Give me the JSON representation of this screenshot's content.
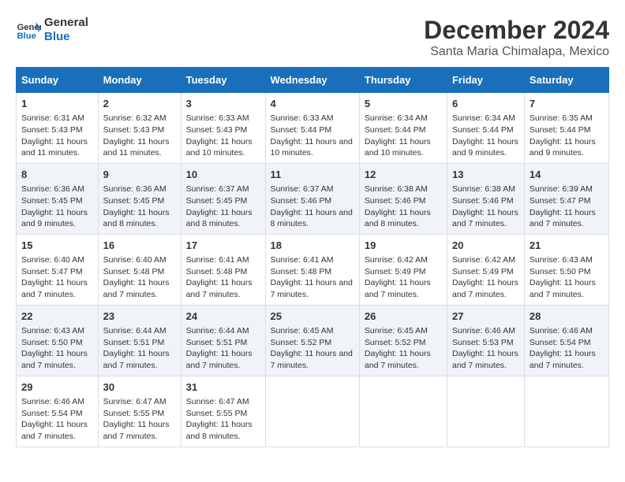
{
  "logo": {
    "line1": "General",
    "line2": "Blue"
  },
  "title": "December 2024",
  "subtitle": "Santa Maria Chimalapa, Mexico",
  "days_of_week": [
    "Sunday",
    "Monday",
    "Tuesday",
    "Wednesday",
    "Thursday",
    "Friday",
    "Saturday"
  ],
  "weeks": [
    [
      {
        "day": "1",
        "info": "Sunrise: 6:31 AM\nSunset: 5:43 PM\nDaylight: 11 hours and 11 minutes."
      },
      {
        "day": "2",
        "info": "Sunrise: 6:32 AM\nSunset: 5:43 PM\nDaylight: 11 hours and 11 minutes."
      },
      {
        "day": "3",
        "info": "Sunrise: 6:33 AM\nSunset: 5:43 PM\nDaylight: 11 hours and 10 minutes."
      },
      {
        "day": "4",
        "info": "Sunrise: 6:33 AM\nSunset: 5:44 PM\nDaylight: 11 hours and 10 minutes."
      },
      {
        "day": "5",
        "info": "Sunrise: 6:34 AM\nSunset: 5:44 PM\nDaylight: 11 hours and 10 minutes."
      },
      {
        "day": "6",
        "info": "Sunrise: 6:34 AM\nSunset: 5:44 PM\nDaylight: 11 hours and 9 minutes."
      },
      {
        "day": "7",
        "info": "Sunrise: 6:35 AM\nSunset: 5:44 PM\nDaylight: 11 hours and 9 minutes."
      }
    ],
    [
      {
        "day": "8",
        "info": "Sunrise: 6:36 AM\nSunset: 5:45 PM\nDaylight: 11 hours and 9 minutes."
      },
      {
        "day": "9",
        "info": "Sunrise: 6:36 AM\nSunset: 5:45 PM\nDaylight: 11 hours and 8 minutes."
      },
      {
        "day": "10",
        "info": "Sunrise: 6:37 AM\nSunset: 5:45 PM\nDaylight: 11 hours and 8 minutes."
      },
      {
        "day": "11",
        "info": "Sunrise: 6:37 AM\nSunset: 5:46 PM\nDaylight: 11 hours and 8 minutes."
      },
      {
        "day": "12",
        "info": "Sunrise: 6:38 AM\nSunset: 5:46 PM\nDaylight: 11 hours and 8 minutes."
      },
      {
        "day": "13",
        "info": "Sunrise: 6:38 AM\nSunset: 5:46 PM\nDaylight: 11 hours and 7 minutes."
      },
      {
        "day": "14",
        "info": "Sunrise: 6:39 AM\nSunset: 5:47 PM\nDaylight: 11 hours and 7 minutes."
      }
    ],
    [
      {
        "day": "15",
        "info": "Sunrise: 6:40 AM\nSunset: 5:47 PM\nDaylight: 11 hours and 7 minutes."
      },
      {
        "day": "16",
        "info": "Sunrise: 6:40 AM\nSunset: 5:48 PM\nDaylight: 11 hours and 7 minutes."
      },
      {
        "day": "17",
        "info": "Sunrise: 6:41 AM\nSunset: 5:48 PM\nDaylight: 11 hours and 7 minutes."
      },
      {
        "day": "18",
        "info": "Sunrise: 6:41 AM\nSunset: 5:48 PM\nDaylight: 11 hours and 7 minutes."
      },
      {
        "day": "19",
        "info": "Sunrise: 6:42 AM\nSunset: 5:49 PM\nDaylight: 11 hours and 7 minutes."
      },
      {
        "day": "20",
        "info": "Sunrise: 6:42 AM\nSunset: 5:49 PM\nDaylight: 11 hours and 7 minutes."
      },
      {
        "day": "21",
        "info": "Sunrise: 6:43 AM\nSunset: 5:50 PM\nDaylight: 11 hours and 7 minutes."
      }
    ],
    [
      {
        "day": "22",
        "info": "Sunrise: 6:43 AM\nSunset: 5:50 PM\nDaylight: 11 hours and 7 minutes."
      },
      {
        "day": "23",
        "info": "Sunrise: 6:44 AM\nSunset: 5:51 PM\nDaylight: 11 hours and 7 minutes."
      },
      {
        "day": "24",
        "info": "Sunrise: 6:44 AM\nSunset: 5:51 PM\nDaylight: 11 hours and 7 minutes."
      },
      {
        "day": "25",
        "info": "Sunrise: 6:45 AM\nSunset: 5:52 PM\nDaylight: 11 hours and 7 minutes."
      },
      {
        "day": "26",
        "info": "Sunrise: 6:45 AM\nSunset: 5:52 PM\nDaylight: 11 hours and 7 minutes."
      },
      {
        "day": "27",
        "info": "Sunrise: 6:46 AM\nSunset: 5:53 PM\nDaylight: 11 hours and 7 minutes."
      },
      {
        "day": "28",
        "info": "Sunrise: 6:46 AM\nSunset: 5:54 PM\nDaylight: 11 hours and 7 minutes."
      }
    ],
    [
      {
        "day": "29",
        "info": "Sunrise: 6:46 AM\nSunset: 5:54 PM\nDaylight: 11 hours and 7 minutes."
      },
      {
        "day": "30",
        "info": "Sunrise: 6:47 AM\nSunset: 5:55 PM\nDaylight: 11 hours and 7 minutes."
      },
      {
        "day": "31",
        "info": "Sunrise: 6:47 AM\nSunset: 5:55 PM\nDaylight: 11 hours and 8 minutes."
      },
      null,
      null,
      null,
      null
    ]
  ]
}
